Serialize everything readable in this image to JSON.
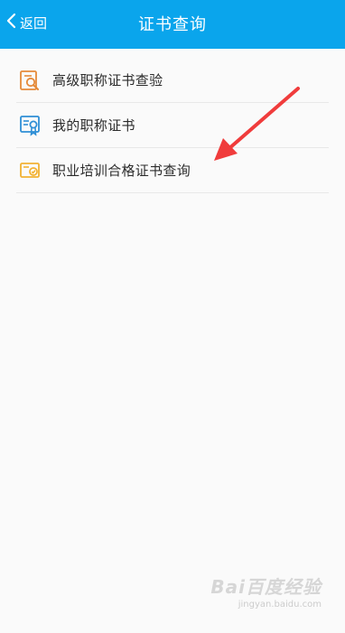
{
  "header": {
    "back_label": "返回",
    "title": "证书查询",
    "background_color": "#0aa5ec"
  },
  "menu": {
    "items": [
      {
        "label": "高级职称证书查验",
        "icon": "certificate-search-icon",
        "icon_color": "#e58a3a"
      },
      {
        "label": "我的职称证书",
        "icon": "certificate-badge-icon",
        "icon_color": "#2f8fd6"
      },
      {
        "label": "职业培训合格证书查询",
        "icon": "certificate-check-icon",
        "icon_color": "#f2b233"
      }
    ]
  },
  "annotation": {
    "arrow_color": "#f03c3c"
  },
  "watermark": {
    "logo": "Bai百度经验",
    "url": "jingyan.baidu.com"
  }
}
